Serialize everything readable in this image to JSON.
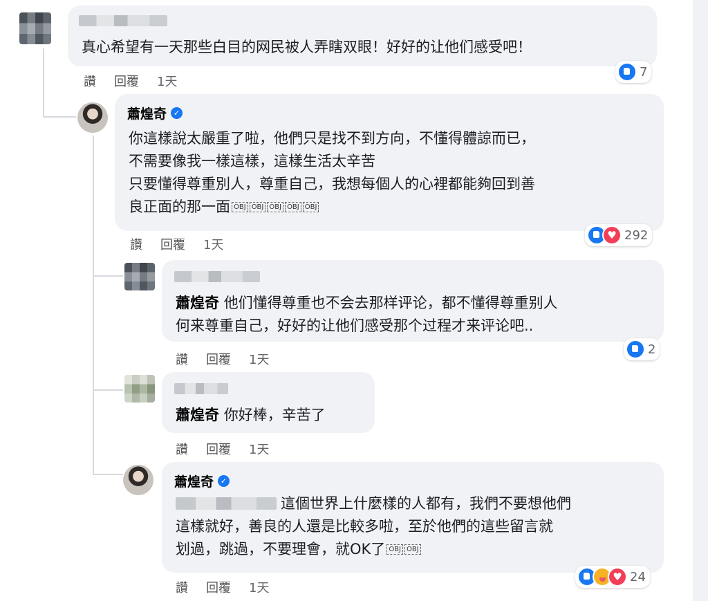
{
  "comments": [
    {
      "text": "真心希望有一天那些白目的网民被人弄瞎双眼！好好的让他们感受吧！",
      "actions": {
        "like": "讚",
        "reply": "回覆",
        "time": "1天"
      },
      "reactions": {
        "count": "7",
        "icons": [
          "like-icon"
        ]
      }
    },
    {
      "author": "蕭煌奇",
      "lines": [
        "你這樣說太嚴重了啦，他們只是找不到方向，不懂得體諒而已，",
        "不需要像我一樣這樣，這樣生活太辛苦",
        "只要懂得尊重別人，尊重自己，我想每個人的心裡都能夠回到善",
        "良正面的那一面"
      ],
      "emotes": [
        "OBJ",
        "OBJ",
        "OBJ",
        "OBJ",
        "OBJ"
      ],
      "actions": {
        "like": "讚",
        "reply": "回覆",
        "time": "1天"
      },
      "reactions": {
        "count": "292",
        "icons": [
          "like-icon",
          "love-icon"
        ]
      }
    },
    {
      "mention": "蕭煌奇",
      "lines": [
        "他们懂得尊重也不会去那样评论，都不懂得尊重别人",
        "何来尊重自己，好好的让他们感受那个过程才来评论吧.."
      ],
      "actions": {
        "like": "讚",
        "reply": "回覆",
        "time": "1天"
      },
      "reactions": {
        "count": "2",
        "icons": [
          "like-icon"
        ]
      }
    },
    {
      "mention": "蕭煌奇",
      "text": "你好棒，辛苦了",
      "actions": {
        "like": "讚",
        "reply": "回覆",
        "time": "1天"
      }
    },
    {
      "author": "蕭煌奇",
      "lines": [
        "這個世界上什麼樣的人都有，我們不要想他們",
        "這樣就好，善良的人還是比較多啦，至於他們的這些留言就",
        "划過，跳過，不要理會，就OK了"
      ],
      "emotes": [
        "OBJ",
        "OBJ"
      ],
      "actions": {
        "like": "讚",
        "reply": "回覆",
        "time": "1天"
      },
      "reactions": {
        "count": "24",
        "icons": [
          "like-icon",
          "care-icon",
          "love-icon"
        ]
      }
    }
  ],
  "colors": {
    "bubble": "#f0f2f5",
    "like": "#1877f2",
    "love": "#f33e58",
    "care": "#f7b125",
    "meta_text": "#65676b"
  }
}
